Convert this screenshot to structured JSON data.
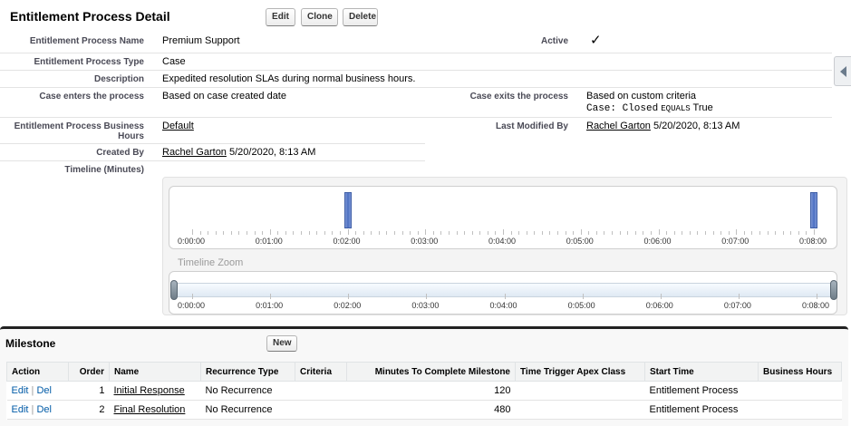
{
  "header": {
    "title": "Entitlement Process Detail",
    "edit_label": "Edit",
    "clone_label": "Clone",
    "delete_label": "Delete"
  },
  "fields": {
    "name_label": "Entitlement Process Name",
    "name_value": "Premium Support",
    "active_label": "Active",
    "active_value": "✓",
    "type_label": "Entitlement Process Type",
    "type_value": "Case",
    "description_label": "Description",
    "description_value": "Expedited resolution SLAs during normal business hours.",
    "enters_label": "Case enters the process",
    "enters_value": "Based on case created date",
    "exits_label": "Case exits the process",
    "exits_value": "Based on custom criteria",
    "exits_criteria_field": "Case: Closed",
    "exits_criteria_op": "EQUALS",
    "exits_criteria_val": "True",
    "hours_label_line1": "Entitlement Process Business",
    "hours_label_line2": "Hours",
    "hours_value": "Default",
    "modified_label": "Last Modified By",
    "modified_user": "Rachel Garton",
    "modified_date": "5/20/2020, 8:13 AM",
    "created_label": "Created By",
    "created_user": "Rachel Garton",
    "created_date": "5/20/2020, 8:13 AM",
    "timeline_label": "Timeline (Minutes)"
  },
  "timeline": {
    "ticks": [
      "0:00:00",
      "0:01:00",
      "0:02:00",
      "0:03:00",
      "0:04:00",
      "0:05:00",
      "0:06:00",
      "0:07:00",
      "0:08:00"
    ],
    "max_minutes": 8,
    "milestone_minutes": [
      2,
      8
    ],
    "zoom_label": "Timeline Zoom"
  },
  "milestones": {
    "title": "Milestone",
    "new_label": "New",
    "columns": [
      "Action",
      "Order",
      "Name",
      "Recurrence Type",
      "Criteria",
      "Minutes To Complete Milestone",
      "Time Trigger Apex Class",
      "Start Time",
      "Business Hours"
    ],
    "edit_label": "Edit",
    "del_label": "Del",
    "action_separator": "|",
    "rows": [
      {
        "order": "1",
        "name": "Initial Response",
        "recurrence": "No Recurrence",
        "criteria": "",
        "minutes": "120",
        "apex": "",
        "start": "Entitlement Process",
        "hours": ""
      },
      {
        "order": "2",
        "name": "Final Resolution",
        "recurrence": "No Recurrence",
        "criteria": "",
        "minutes": "480",
        "apex": "",
        "start": "Entitlement Process",
        "hours": ""
      }
    ]
  },
  "icons": {
    "side_tab": "collapse-arrow-left-icon",
    "active_check": "checkmark-icon"
  }
}
